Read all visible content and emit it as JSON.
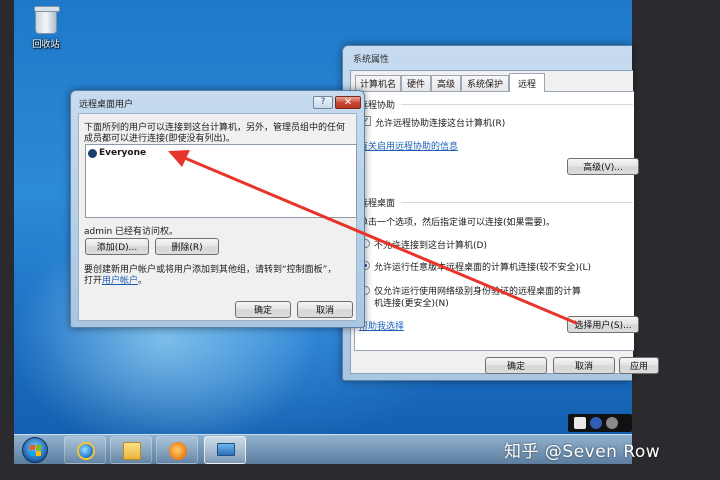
{
  "desktop": {
    "recycle_bin_label": "回收站"
  },
  "system_properties": {
    "title": "系统属性",
    "tabs": [
      "计算机名",
      "硬件",
      "高级",
      "系统保护",
      "远程"
    ],
    "selected_tab": "远程",
    "remote_assistance": {
      "group_label": "远程协助",
      "allow_checkbox_label": "允许远程协助连接这台计算机(R)",
      "allow_checked": true,
      "info_link": "有关启用远程协助的信息",
      "advanced_button": "高级(V)..."
    },
    "remote_desktop": {
      "group_label": "远程桌面",
      "instruction": "单击一个选项，然后指定谁可以连接(如果需要)。",
      "options": [
        {
          "label": "不允许连接到这台计算机(D)",
          "selected": false
        },
        {
          "label": "允许运行任意版本远程桌面的计算机连接(较不安全)(L)",
          "selected": true
        },
        {
          "label_line1": "仅允许运行使用网络级别身份验证的远程桌面的计算",
          "label_line2": "机连接(更安全)(N)",
          "selected": false
        }
      ],
      "help_link": "帮助我选择",
      "select_users_button": "选择用户(S)..."
    },
    "buttons": {
      "ok": "确定",
      "cancel": "取消",
      "apply": "应用"
    }
  },
  "remote_desktop_users": {
    "title": "远程桌面用户",
    "help_btn": "?",
    "close_btn": "✕",
    "description_line1": "下面所列的用户可以连接到这台计算机，另外，管理员组中的任何",
    "description_line2": "成员都可以进行连接(即使没有列出)。",
    "users": [
      "Everyone"
    ],
    "access_status": "admin 已经有访问权。",
    "add_button": "添加(D)...",
    "remove_button": "删除(R)",
    "footer_line1": "要创建新用户帐户或将用户添加到其他组，请转到“控制面板”，",
    "footer_line2_prefix": "打开",
    "footer_link": "用户帐户",
    "footer_line2_suffix": "。",
    "ok_button": "确定",
    "cancel_button": "取消"
  },
  "taskbar": {
    "items": [
      "start",
      "internet-explorer",
      "windows-explorer",
      "media-player",
      "remote-desktop"
    ],
    "active_item": "remote-desktop"
  },
  "watermark": "知乎 @Seven Row",
  "colors": {
    "annotation_arrow": "#e8352b",
    "link": "#1d5fb5",
    "close_button": "#c7452f"
  }
}
